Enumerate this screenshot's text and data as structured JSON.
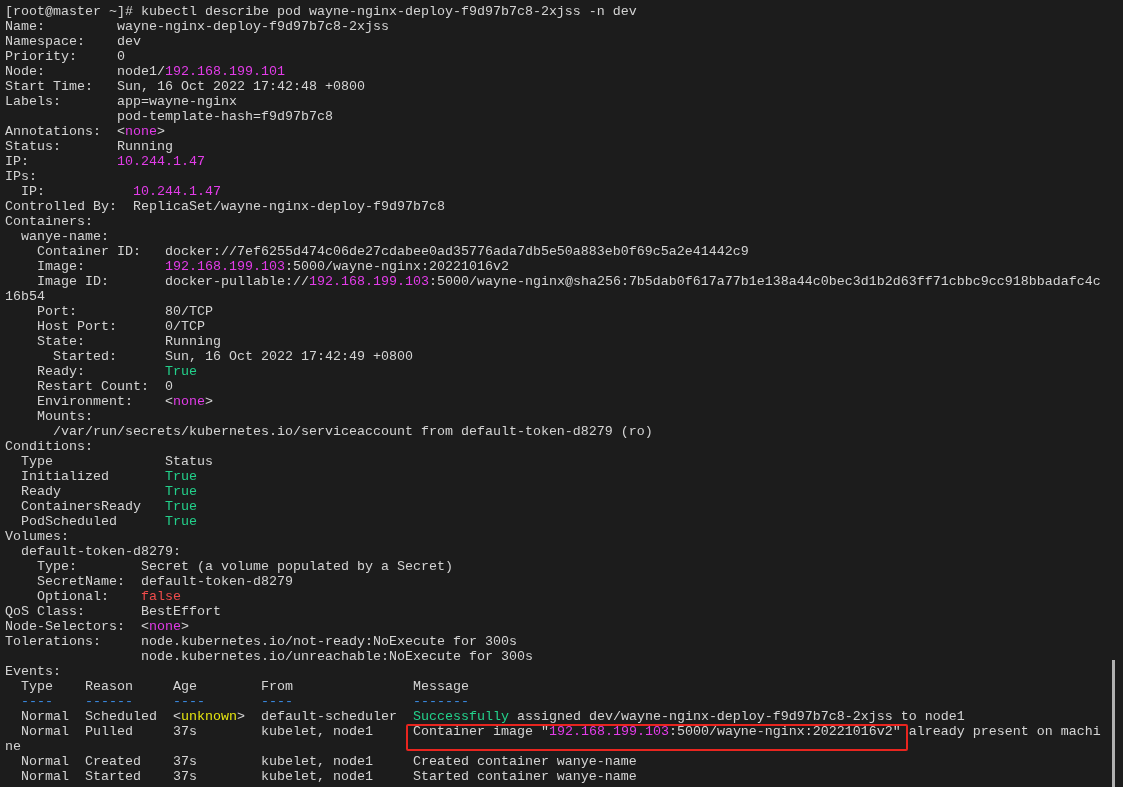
{
  "terminal": {
    "lines": [
      {
        "segments": [
          {
            "text": "[root@master ~]# kubectl describe pod wayne-nginx-deploy-f9d97b7c8-2xjss -n dev",
            "kind": "plain"
          }
        ]
      },
      {
        "segments": [
          {
            "text": "Name:         wayne-nginx-deploy-f9d97b7c8-2xjss",
            "kind": "plain"
          }
        ]
      },
      {
        "segments": [
          {
            "text": "Namespace:    dev",
            "kind": "plain"
          }
        ]
      },
      {
        "segments": [
          {
            "text": "Priority:     0",
            "kind": "plain"
          }
        ]
      },
      {
        "segments": [
          {
            "text": "Node:         node1/",
            "kind": "plain"
          },
          {
            "text": "192.168.199.101",
            "kind": "magenta"
          }
        ]
      },
      {
        "segments": [
          {
            "text": "Start Time:   Sun, 16 Oct 2022 17:42:48 +0800",
            "kind": "plain"
          }
        ]
      },
      {
        "segments": [
          {
            "text": "Labels:       app=wayne-nginx",
            "kind": "plain"
          }
        ]
      },
      {
        "segments": [
          {
            "text": "              pod-template-hash=f9d97b7c8",
            "kind": "plain"
          }
        ]
      },
      {
        "segments": [
          {
            "text": "Annotations:  <",
            "kind": "plain"
          },
          {
            "text": "none",
            "kind": "magenta"
          },
          {
            "text": ">",
            "kind": "plain"
          }
        ]
      },
      {
        "segments": [
          {
            "text": "Status:       Running",
            "kind": "plain"
          }
        ]
      },
      {
        "segments": [
          {
            "text": "IP:           ",
            "kind": "plain"
          },
          {
            "text": "10.244.1.47",
            "kind": "magenta"
          }
        ]
      },
      {
        "segments": [
          {
            "text": "IPs:",
            "kind": "plain"
          }
        ]
      },
      {
        "segments": [
          {
            "text": "  IP:           ",
            "kind": "plain"
          },
          {
            "text": "10.244.1.47",
            "kind": "magenta"
          }
        ]
      },
      {
        "segments": [
          {
            "text": "Controlled By:  ReplicaSet/wayne-nginx-deploy-f9d97b7c8",
            "kind": "plain"
          }
        ]
      },
      {
        "segments": [
          {
            "text": "Containers:",
            "kind": "plain"
          }
        ]
      },
      {
        "segments": [
          {
            "text": "  wanye-name:",
            "kind": "plain"
          }
        ]
      },
      {
        "segments": [
          {
            "text": "    Container ID:   docker://7ef6255d474c06de27cdabee0ad35776ada7db5e50a883eb0f69c5a2e41442c9",
            "kind": "plain"
          }
        ]
      },
      {
        "segments": [
          {
            "text": "    Image:          ",
            "kind": "plain"
          },
          {
            "text": "192.168.199.103",
            "kind": "magenta"
          },
          {
            "text": ":5000/wayne-nginx:20221016v2",
            "kind": "plain"
          }
        ]
      },
      {
        "segments": [
          {
            "text": "    Image ID:       docker-pullable://",
            "kind": "plain"
          },
          {
            "text": "192.168.199.103",
            "kind": "magenta"
          },
          {
            "text": ":5000/wayne-nginx@sha256:7b5dab0f617a77b1e138a44c0bec3d1b2d63ff71cbbc9cc918bbadafc4c",
            "kind": "plain"
          }
        ]
      },
      {
        "segments": [
          {
            "text": "16b54",
            "kind": "plain"
          }
        ]
      },
      {
        "segments": [
          {
            "text": "    Port:           80/TCP",
            "kind": "plain"
          }
        ]
      },
      {
        "segments": [
          {
            "text": "    Host Port:      0/TCP",
            "kind": "plain"
          }
        ]
      },
      {
        "segments": [
          {
            "text": "    State:          Running",
            "kind": "plain"
          }
        ]
      },
      {
        "segments": [
          {
            "text": "      Started:      Sun, 16 Oct 2022 17:42:49 +0800",
            "kind": "plain"
          }
        ]
      },
      {
        "segments": [
          {
            "text": "    Ready:          ",
            "kind": "plain"
          },
          {
            "text": "True",
            "kind": "green"
          }
        ]
      },
      {
        "segments": [
          {
            "text": "    Restart Count:  0",
            "kind": "plain"
          }
        ]
      },
      {
        "segments": [
          {
            "text": "    Environment:    <",
            "kind": "plain"
          },
          {
            "text": "none",
            "kind": "magenta"
          },
          {
            "text": ">",
            "kind": "plain"
          }
        ]
      },
      {
        "segments": [
          {
            "text": "    Mounts:",
            "kind": "plain"
          }
        ]
      },
      {
        "segments": [
          {
            "text": "      /var/run/secrets/kubernetes.io/serviceaccount from default-token-d8279 (ro)",
            "kind": "plain"
          }
        ]
      },
      {
        "segments": [
          {
            "text": "Conditions:",
            "kind": "plain"
          }
        ]
      },
      {
        "segments": [
          {
            "text": "  Type              Status",
            "kind": "plain"
          }
        ]
      },
      {
        "segments": [
          {
            "text": "  Initialized       ",
            "kind": "plain"
          },
          {
            "text": "True",
            "kind": "green"
          }
        ]
      },
      {
        "segments": [
          {
            "text": "  Ready             ",
            "kind": "plain"
          },
          {
            "text": "True",
            "kind": "green"
          }
        ]
      },
      {
        "segments": [
          {
            "text": "  ContainersReady   ",
            "kind": "plain"
          },
          {
            "text": "True",
            "kind": "green"
          }
        ]
      },
      {
        "segments": [
          {
            "text": "  PodScheduled      ",
            "kind": "plain"
          },
          {
            "text": "True",
            "kind": "green"
          }
        ]
      },
      {
        "segments": [
          {
            "text": "Volumes:",
            "kind": "plain"
          }
        ]
      },
      {
        "segments": [
          {
            "text": "  default-token-d8279:",
            "kind": "plain"
          }
        ]
      },
      {
        "segments": [
          {
            "text": "    Type:        Secret (a volume populated by a Secret)",
            "kind": "plain"
          }
        ]
      },
      {
        "segments": [
          {
            "text": "    SecretName:  default-token-d8279",
            "kind": "plain"
          }
        ]
      },
      {
        "segments": [
          {
            "text": "    Optional:    ",
            "kind": "plain"
          },
          {
            "text": "false",
            "kind": "red"
          }
        ]
      },
      {
        "segments": [
          {
            "text": "QoS Class:       BestEffort",
            "kind": "plain"
          }
        ]
      },
      {
        "segments": [
          {
            "text": "Node-Selectors:  <",
            "kind": "plain"
          },
          {
            "text": "none",
            "kind": "magenta"
          },
          {
            "text": ">",
            "kind": "plain"
          }
        ]
      },
      {
        "segments": [
          {
            "text": "Tolerations:     node.kubernetes.io/not-ready:NoExecute for 300s",
            "kind": "plain"
          }
        ]
      },
      {
        "segments": [
          {
            "text": "                 node.kubernetes.io/unreachable:NoExecute for 300s",
            "kind": "plain"
          }
        ]
      },
      {
        "segments": [
          {
            "text": "Events:",
            "kind": "plain"
          }
        ]
      },
      {
        "segments": [
          {
            "text": "  Type    Reason     Age        From               Message",
            "kind": "plain"
          }
        ]
      },
      {
        "segments": [
          {
            "text": "  ----    ------     ----       ----               -------",
            "kind": "blue"
          }
        ]
      },
      {
        "segments": [
          {
            "text": "  Normal  Scheduled  <",
            "kind": "plain"
          },
          {
            "text": "unknown",
            "kind": "yellow"
          },
          {
            "text": ">  default-scheduler  ",
            "kind": "plain"
          },
          {
            "text": "Successfully",
            "kind": "green"
          },
          {
            "text": " assigned dev/wayne-nginx-deploy-f9d97b7c8-2xjss to node1",
            "kind": "plain"
          }
        ]
      },
      {
        "segments": [
          {
            "text": "  Normal  Pulled     37s        kubelet, node1     ",
            "kind": "plain"
          },
          {
            "text": "Container image \"",
            "kind": "plain",
            "boxed": true
          },
          {
            "text": "192.168.199.103",
            "kind": "magenta",
            "boxed": true
          },
          {
            "text": ":5000/wayne-nginx:20221016v2\"",
            "kind": "plain",
            "boxed": true
          },
          {
            "text": " already present on machi",
            "kind": "plain"
          }
        ]
      },
      {
        "segments": [
          {
            "text": "ne",
            "kind": "plain"
          }
        ]
      },
      {
        "segments": [
          {
            "text": "  Normal  Created    37s        kubelet, node1     Created container wanye-name",
            "kind": "plain"
          }
        ]
      },
      {
        "segments": [
          {
            "text": "  Normal  Started    37s        kubelet, node1     Started container wanye-name",
            "kind": "plain"
          }
        ]
      }
    ]
  }
}
